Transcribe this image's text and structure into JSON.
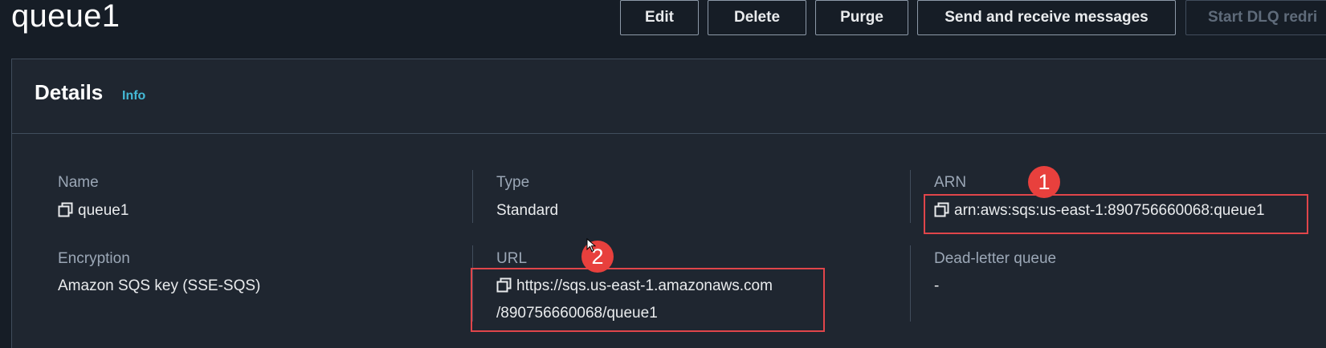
{
  "queue_title": "queue1",
  "actions": {
    "edit": "Edit",
    "delete": "Delete",
    "purge": "Purge",
    "send_receive": "Send and receive messages",
    "start_dlq": "Start DLQ redri"
  },
  "details": {
    "title": "Details",
    "info": "Info",
    "name_label": "Name",
    "name_value": "queue1",
    "type_label": "Type",
    "type_value": "Standard",
    "arn_label": "ARN",
    "arn_value": "arn:aws:sqs:us-east-1:890756660068:queue1",
    "encryption_label": "Encryption",
    "encryption_value": "Amazon SQS key (SSE-SQS)",
    "url_label": "URL",
    "url_line1": "https://sqs.us-east-1.amazonaws.com",
    "url_line2": "/890756660068/queue1",
    "dlq_label": "Dead-letter queue",
    "dlq_value": "-"
  },
  "annotations": {
    "badge1": "1",
    "badge2": "2"
  },
  "colors": {
    "background": "#161d26",
    "panel": "#1f2630",
    "info_link": "#44b9d6",
    "highlight": "#e0454a"
  },
  "icons": [
    "copy-icon",
    "pointer-cursor-icon"
  ]
}
